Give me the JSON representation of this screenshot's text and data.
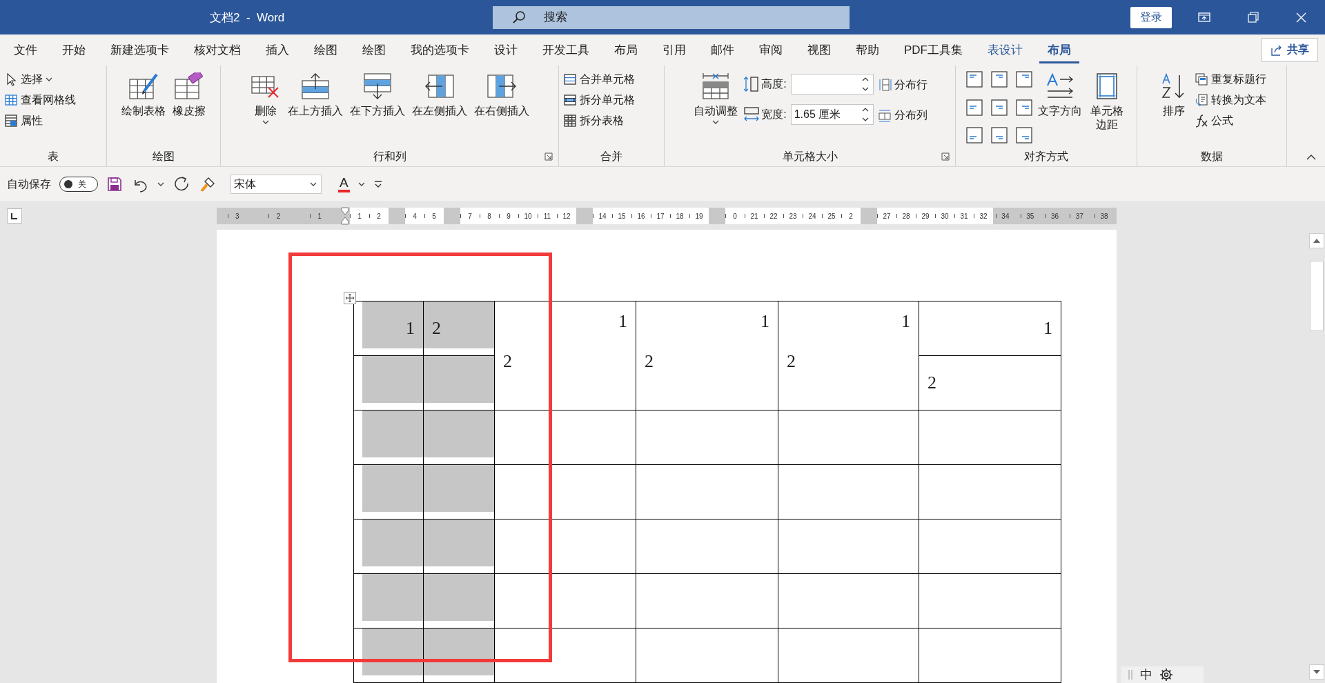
{
  "window": {
    "title": "文档2  -  Word",
    "search": {
      "placeholder": "搜索"
    },
    "login_button": "登录"
  },
  "tabs": [
    {
      "label": "文件",
      "selected": false,
      "contextual": false
    },
    {
      "label": "开始",
      "selected": false,
      "contextual": false
    },
    {
      "label": "新建选项卡",
      "selected": false,
      "contextual": false
    },
    {
      "label": "核对文档",
      "selected": false,
      "contextual": false
    },
    {
      "label": "插入",
      "selected": false,
      "contextual": false
    },
    {
      "label": "绘图",
      "selected": false,
      "contextual": false
    },
    {
      "label": "绘图",
      "selected": false,
      "contextual": false
    },
    {
      "label": "我的选项卡",
      "selected": false,
      "contextual": false
    },
    {
      "label": "设计",
      "selected": false,
      "contextual": false
    },
    {
      "label": "开发工具",
      "selected": false,
      "contextual": false
    },
    {
      "label": "布局",
      "selected": false,
      "contextual": false
    },
    {
      "label": "引用",
      "selected": false,
      "contextual": false
    },
    {
      "label": "邮件",
      "selected": false,
      "contextual": false
    },
    {
      "label": "审阅",
      "selected": false,
      "contextual": false
    },
    {
      "label": "视图",
      "selected": false,
      "contextual": false
    },
    {
      "label": "帮助",
      "selected": false,
      "contextual": false
    },
    {
      "label": "PDF工具集",
      "selected": false,
      "contextual": false
    },
    {
      "label": "表设计",
      "selected": false,
      "contextual": true
    },
    {
      "label": "布局",
      "selected": true,
      "contextual": true
    }
  ],
  "share_button": "共享",
  "ribbon": {
    "groups": [
      {
        "label": "表",
        "columns": [
          {
            "kind": "stack",
            "entries": [
              {
                "label": "选择",
                "dropdown": true
              },
              {
                "label": "查看网格线",
                "dropdown": false
              },
              {
                "label": "属性",
                "dropdown": false
              }
            ]
          }
        ]
      },
      {
        "label": "绘图",
        "columns": [
          {
            "kind": "large",
            "label": "绘制表格",
            "dropdown": false
          },
          {
            "kind": "large",
            "label": "橡皮擦",
            "dropdown": false
          }
        ]
      },
      {
        "label": "行和列",
        "launcher": true,
        "columns": [
          {
            "kind": "large",
            "label": "删除",
            "dropdown": true
          },
          {
            "kind": "large",
            "label": "在上方插入",
            "dropdown": false
          },
          {
            "kind": "large",
            "label": "在下方插入",
            "dropdown": false
          },
          {
            "kind": "large",
            "label": "在左侧插入",
            "dropdown": false
          },
          {
            "kind": "large",
            "label": "在右侧插入",
            "dropdown": false
          }
        ]
      },
      {
        "label": "合并",
        "columns": [
          {
            "kind": "stack",
            "entries": [
              {
                "label": "合并单元格",
                "dropdown": false
              },
              {
                "label": "拆分单元格",
                "dropdown": false
              },
              {
                "label": "拆分表格",
                "dropdown": false
              }
            ]
          }
        ]
      },
      {
        "label": "单元格大小",
        "launcher": true,
        "columns": [
          {
            "kind": "large",
            "label": "自动调整",
            "dropdown": true
          },
          {
            "kind": "spinners",
            "entries": [
              {
                "label": "高度:"
              },
              {
                "label": "宽度:",
                "value": "1.65 厘米"
              }
            ]
          },
          {
            "kind": "stack",
            "entries": [
              {
                "label": "分布行",
                "dropdown": false
              },
              {
                "label": "分布列",
                "dropdown": false
              }
            ]
          }
        ]
      },
      {
        "label": "对齐方式",
        "columns": [
          {
            "kind": "align-grid"
          },
          {
            "kind": "large",
            "label": "文字方向",
            "dropdown": false
          },
          {
            "kind": "large",
            "label": "单元格边距",
            "dropdown": false
          }
        ]
      },
      {
        "label": "数据",
        "columns": [
          {
            "kind": "large",
            "label": "排序",
            "dropdown": false
          },
          {
            "kind": "stack",
            "entries": [
              {
                "label": "重复标题行",
                "dropdown": false
              },
              {
                "label": "转换为文本",
                "dropdown": false
              },
              {
                "label": "公式",
                "dropdown": false
              }
            ]
          }
        ]
      }
    ]
  },
  "qat": {
    "autosave": {
      "label": "自动保存",
      "toggle_text": "关",
      "on": false
    },
    "font": "宋体",
    "font_color_letter": "A"
  },
  "ruler": {
    "segments": [
      {
        "kind": "margin",
        "numbers": [
          "3",
          "2",
          "1"
        ]
      },
      {
        "kind": "marker"
      },
      {
        "kind": "text",
        "numbers": [
          "1",
          "2"
        ]
      },
      {
        "kind": "gap"
      },
      {
        "kind": "text",
        "numbers": [
          "4",
          "5"
        ]
      },
      {
        "kind": "gap"
      },
      {
        "kind": "text",
        "numbers": [
          "7",
          "8",
          "9",
          "10",
          "11",
          "12"
        ]
      },
      {
        "kind": "gap"
      },
      {
        "kind": "text",
        "numbers": [
          "14",
          "15",
          "16",
          "17",
          "18",
          "19"
        ]
      },
      {
        "kind": "gap"
      },
      {
        "kind": "text",
        "numbers": [
          "0",
          "21",
          "22",
          "23",
          "24",
          "25",
          "2"
        ]
      },
      {
        "kind": "gap"
      },
      {
        "kind": "text",
        "numbers": [
          "27",
          "28",
          "29",
          "30",
          "31",
          "32"
        ]
      },
      {
        "kind": "margin",
        "numbers": [
          "34",
          "35",
          "36",
          "37",
          "38"
        ]
      }
    ]
  },
  "table": {
    "rows": [
      {
        "cells": [
          {
            "text": "1",
            "align_right": true,
            "shaded": true
          },
          {
            "text": "2",
            "align_right": false,
            "shaded": true
          },
          {
            "lines": [
              {
                "text": "1"
              },
              {
                "text": "2"
              }
            ],
            "rowspan": 2,
            "shaded": false
          },
          {
            "lines": [
              {
                "text": "1"
              },
              {
                "text": "2"
              }
            ],
            "rowspan": 2,
            "shaded": false
          },
          {
            "lines": [
              {
                "text": "1"
              },
              {
                "text": "2"
              }
            ],
            "rowspan": 2,
            "shaded": false
          },
          {
            "text": "1",
            "align_right": true,
            "shaded": false
          }
        ]
      },
      {
        "cells": [
          {
            "shaded": true
          },
          {
            "shaded": true
          },
          {
            "text": "2",
            "align_right": false,
            "shaded": false
          }
        ]
      },
      {
        "cells": [
          {
            "shaded": true
          },
          {
            "shaded": true
          },
          {
            "shaded": false
          },
          {
            "shaded": false
          },
          {
            "shaded": false
          },
          {
            "shaded": false
          }
        ]
      },
      {
        "cells": [
          {
            "shaded": true
          },
          {
            "shaded": true
          },
          {
            "shaded": false
          },
          {
            "shaded": false
          },
          {
            "shaded": false
          },
          {
            "shaded": false
          }
        ]
      },
      {
        "cells": [
          {
            "shaded": true
          },
          {
            "shaded": true
          },
          {
            "shaded": false
          },
          {
            "shaded": false
          },
          {
            "shaded": false
          },
          {
            "shaded": false
          }
        ]
      },
      {
        "cells": [
          {
            "shaded": true
          },
          {
            "shaded": true
          },
          {
            "shaded": false
          },
          {
            "shaded": false
          },
          {
            "shaded": false
          },
          {
            "shaded": false
          }
        ]
      },
      {
        "cells": [
          {
            "shaded": true
          },
          {
            "shaded": true
          },
          {
            "shaded": false
          },
          {
            "shaded": false
          },
          {
            "shaded": false
          },
          {
            "shaded": false
          }
        ]
      }
    ]
  },
  "ime_bar": {
    "mode": "中"
  }
}
